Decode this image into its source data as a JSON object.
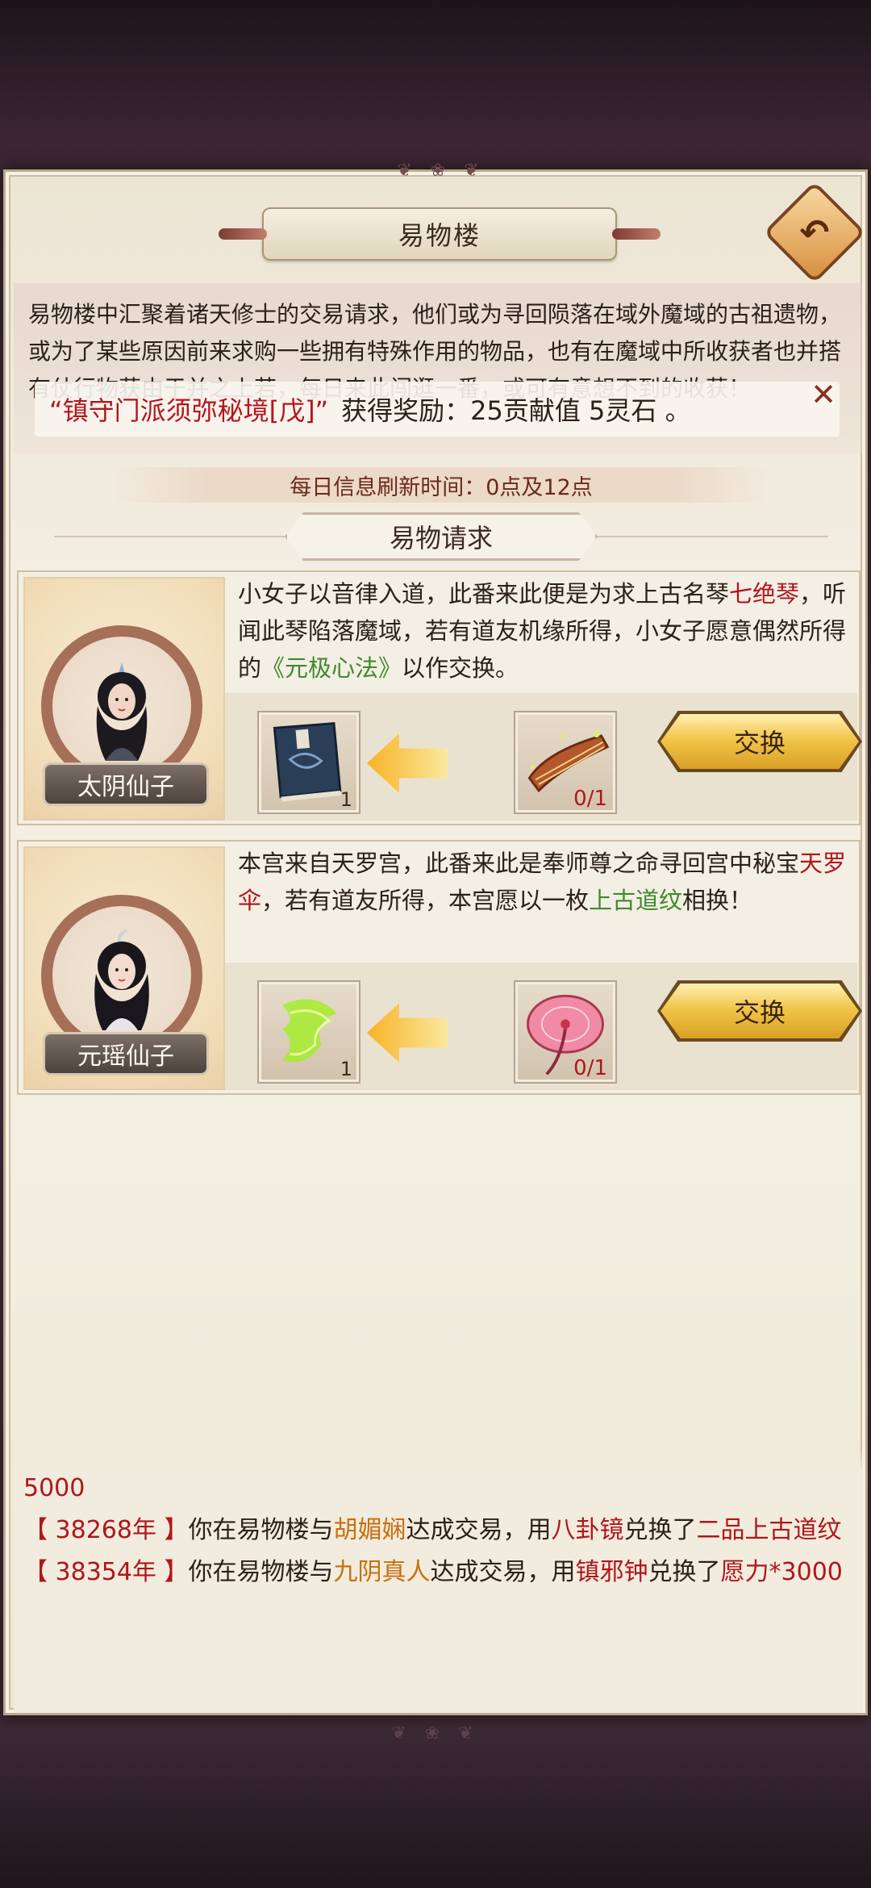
{
  "header": {
    "title": "易物楼",
    "back_icon": "back-arrow-icon"
  },
  "intro": {
    "text": "易物楼中汇聚着诸天修士的交易请求，他们或为寻回陨落在域外魔域的古祖遗物，或为了某些原因前来求购一些拥有特殊作用的物品，也有在魔域中所收获者也并搭有仗行物获由于并之上若，每日来此闯逛一番，或可有意想不到的收获！"
  },
  "toast": {
    "quest": "“镇守门派须弥秘境[戊]”",
    "reward": "获得奖励：25贡献值 5灵石 。",
    "close_icon": "close-icon"
  },
  "refresh": {
    "text": "每日信息刷新时间：0点及12点"
  },
  "section": {
    "title": "易物请求"
  },
  "requests": [
    {
      "name": "太阴仙子",
      "text_a": "小女子以音律入道，此番来此便是为求上古名琴",
      "item_wanted": "七绝琴",
      "text_b": "，听闻此琴陷落魔域，若有道友机缘所得，小女子愿意偶然所得的",
      "item_offered": "《元极心法》",
      "text_c": "以作交换。",
      "reward_count": "1",
      "need_count": "0/1",
      "button": "交换",
      "reward_icon": "book-icon",
      "need_icon": "zither-icon"
    },
    {
      "name": "元瑶仙子",
      "text_a": "本宫来自天罗宫，此番来此是奉师尊之命寻回宫中秘宝",
      "item_wanted": "天罗伞",
      "text_b": "，若有道友所得，本宫愿以一枚",
      "item_offered": "上古道纹",
      "text_c": "相换！",
      "reward_count": "1",
      "need_count": "0/1",
      "button": "交换",
      "reward_icon": "dao-pattern-icon",
      "need_icon": "umbrella-icon"
    }
  ],
  "log": {
    "cut_line": "5000",
    "entries": [
      {
        "year": "【 38268年 】",
        "t1": "你在易物楼与",
        "npc": "胡媚娴",
        "t2": "达成交易，用",
        "give": "八卦镜",
        "t3": "兑换了",
        "got": "二品上古道纹"
      },
      {
        "year": "【 38354年 】",
        "t1": "你在易物楼与",
        "npc": "九阴真人",
        "t2": "达成交易，用",
        "give": "镇邪钟",
        "t3": "兑换了",
        "got": "愿力*3000"
      }
    ]
  }
}
